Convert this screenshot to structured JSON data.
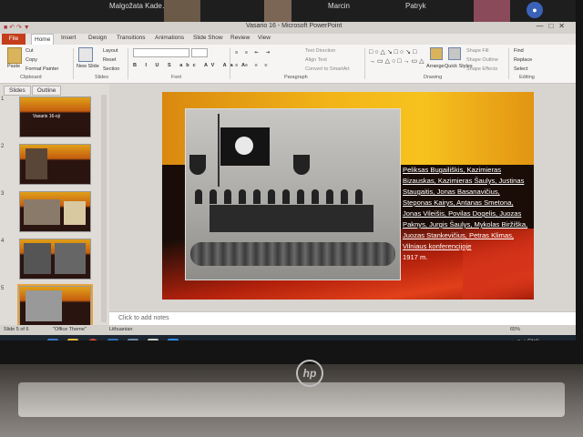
{
  "meeting": {
    "participants": [
      "Malgožata Kade…",
      "Marcin",
      "Patryk"
    ]
  },
  "window": {
    "title": "Vasario 16 - Microsoft PowerPoint"
  },
  "ribbon_tabs": [
    "File",
    "Home",
    "Insert",
    "Design",
    "Transitions",
    "Animations",
    "Slide Show",
    "Review",
    "View"
  ],
  "ribbon": {
    "paste": "Paste",
    "cut": "Cut",
    "copy": "Copy",
    "format_painter": "Format Painter",
    "new_slide": "New Slide",
    "layout": "Layout",
    "reset": "Reset",
    "section": "Section",
    "text_direction": "Text Direction",
    "align_text": "Align Text",
    "convert_smartart": "Convert to SmartArt",
    "arrange": "Arrange",
    "quick_styles": "Quick Styles",
    "shape_fill": "Shape Fill",
    "shape_outline": "Shape Outline",
    "shape_effects": "Shape Effects",
    "find": "Find",
    "replace": "Replace",
    "select": "Select",
    "groups": {
      "clipboard": "Clipboard",
      "slides": "Slides",
      "font": "Font",
      "paragraph": "Paragraph",
      "drawing": "Drawing",
      "editing": "Editing"
    }
  },
  "pane_tabs": [
    "Slides",
    "Outline"
  ],
  "slides": [
    {
      "num": "1",
      "caption": "Vasaris 16-oji"
    },
    {
      "num": "2",
      "caption": ""
    },
    {
      "num": "3",
      "caption": ""
    },
    {
      "num": "4",
      "caption": ""
    },
    {
      "num": "5",
      "caption": ""
    }
  ],
  "slide_text": {
    "linked": "Peliksas Bugailiškis, Kazimieras Bizauskas, Kazimieras Šaulys, Justinas Staugaitis, Jonas Basanavičius, Steponas Kairys, Antanas Smetona, Jonas Vileišis, Povilas Dogelis, Juozas Paknys, Jurgis Šaulys, Mykolas Biržiška, Juozas Stankevičius, Petras Klimas, Vilniaus konferencijoje",
    "year": "1917 m."
  },
  "notes_placeholder": "Click to add notes",
  "status": {
    "slide": "Slide 5 of 6",
    "theme": "\"Office Theme\"",
    "language": "Lithuanian",
    "zoom": "65%"
  },
  "colors": {
    "file_tab": "#c43e1c",
    "slide_sky": "#f2b418",
    "slide_red": "#b3210c"
  }
}
